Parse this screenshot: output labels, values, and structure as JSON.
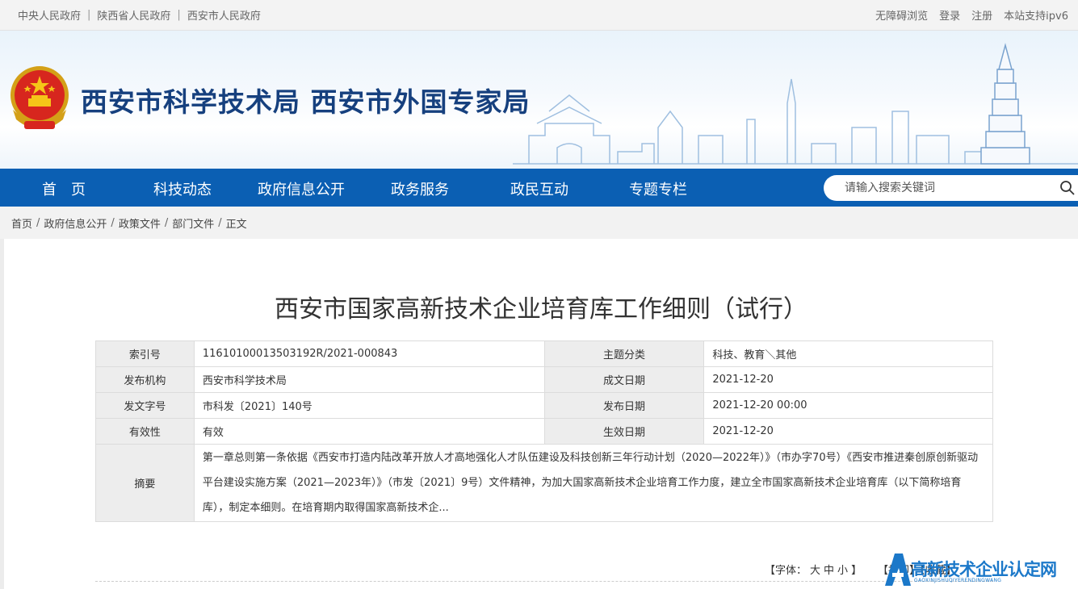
{
  "topbar": {
    "links": [
      "中央人民政府",
      "陕西省人民政府",
      "西安市人民政府"
    ],
    "separator": "|",
    "right": [
      "无障碍浏览",
      "登录",
      "注册",
      "本站支持ipv6"
    ]
  },
  "banner": {
    "title": "西安市科学技术局 西安市外国专家局"
  },
  "nav": {
    "items": [
      "首　页",
      "科技动态",
      "政府信息公开",
      "政务服务",
      "政民互动",
      "专题专栏"
    ],
    "search_placeholder": "请输入搜索关键词"
  },
  "breadcrumb": {
    "items": [
      "首页",
      "政府信息公开",
      "政策文件",
      "部门文件",
      "正文"
    ],
    "sep": "/"
  },
  "document": {
    "title": "西安市国家高新技术企业培育库工作细则（试行）",
    "meta": {
      "index_label": "索引号",
      "index_value": "11610100013503192R/2021-000843",
      "topic_label": "主题分类",
      "topic_value": "科技、教育＼其他",
      "org_label": "发布机构",
      "org_value": "西安市科学技术局",
      "date_label": "成文日期",
      "date_value": "2021-12-20",
      "docno_label": "发文字号",
      "docno_value": "市科发〔2021〕140号",
      "pubdate_label": "发布日期",
      "pubdate_value": "2021-12-20 00:00",
      "valid_label": "有效性",
      "valid_value": "有效",
      "effective_label": "生效日期",
      "effective_value": "2021-12-20",
      "summary_label": "摘要",
      "summary_value": "第一章总则第一条依据《西安市打造内陆改革开放人才高地强化人才队伍建设及科技创新三年行动计划（2020—2022年）》（市办字70号）《西安市推进秦创原创新驱动平台建设实施方案（2021—2023年）》（市发〔2021〕9号）文件精神，为加大国家高新技术企业培育工作力度，建立全市国家高新技术企业培育库（以下简称培育库），制定本细则。在培育期内取得国家高新技术企..."
    },
    "font_tools": {
      "prefix": "【字体：",
      "large": "大",
      "medium": "中",
      "small": "小",
      "suffix": "】"
    },
    "extra_tools": "【打印】【收藏】"
  },
  "watermark": {
    "text": "高新技术企业认定网",
    "sub": "GAOXINJISHUQIYERENDINGWANG"
  },
  "colors": {
    "nav_blue": "#0b5fb3",
    "title_navy": "#16407e",
    "watermark_blue": "#1b78c9"
  }
}
